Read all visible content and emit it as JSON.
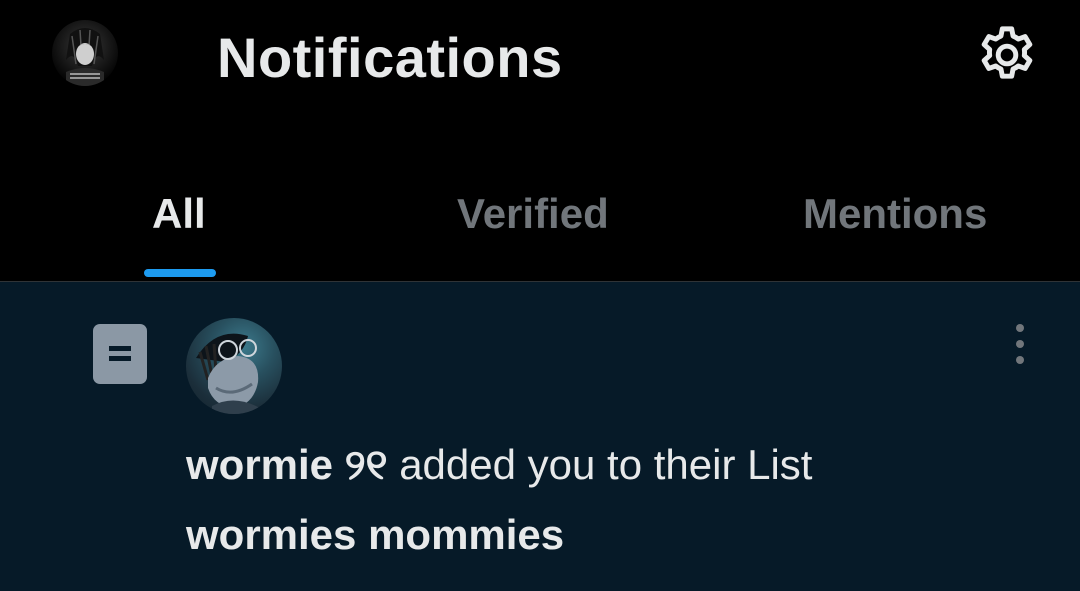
{
  "header": {
    "title": "Notifications",
    "avatar_icon": "profile-avatar",
    "settings_icon": "gear-icon"
  },
  "tabs": [
    {
      "label": "All",
      "active": true
    },
    {
      "label": "Verified",
      "active": false
    },
    {
      "label": "Mentions",
      "active": false
    }
  ],
  "notification": {
    "type_icon": "list-icon",
    "user_name": "wormie ୨୧",
    "action_text": "added you to their List",
    "list_name": "wormies mommies",
    "more_icon": "more-vertical-icon"
  },
  "colors": {
    "background": "#000000",
    "accent": "#1d9bf0",
    "notification_bg": "#061a28",
    "muted_text": "#71767b",
    "primary_text": "#e7e9ea"
  }
}
